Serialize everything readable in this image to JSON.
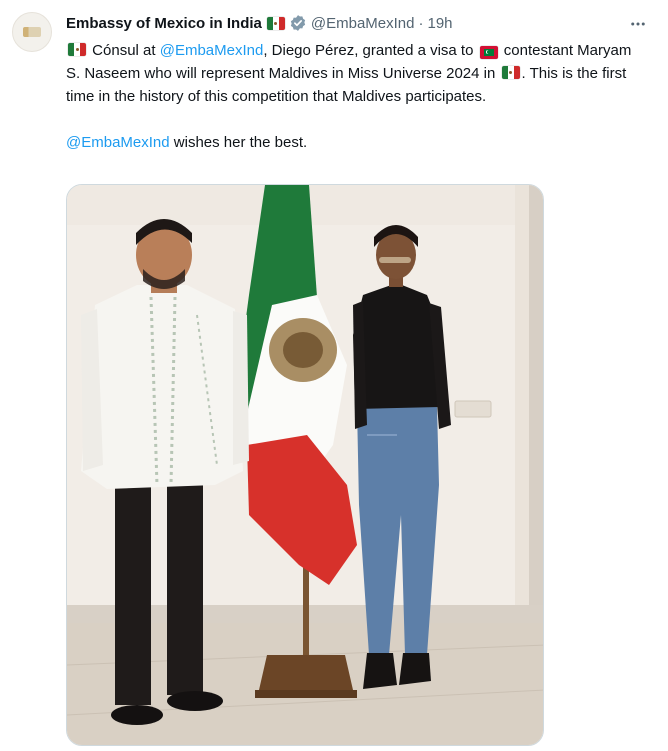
{
  "tweet": {
    "display_name": "Embassy of Mexico in India",
    "handle": "@EmbaMexInd",
    "separator": "·",
    "time": "19h",
    "body": {
      "p1_a": "Cónsul at ",
      "p1_mention": "@EmbaMexInd",
      "p1_b": ", Diego Pérez, granted a visa to ",
      "p1_c": " contestant Maryam S. Naseem who will represent Maldives in Miss Universe 2024 in ",
      "p1_d": ". This is the first time in the history of this competition that Maldives participates.",
      "p2_mention": "@EmbaMexInd",
      "p2_b": " wishes her the best."
    }
  },
  "icons": {
    "more": "more-horizontal-icon",
    "verified": "verified-badge-icon",
    "flag_mexico": "mexico-flag-icon",
    "flag_maldives": "maldives-flag-icon"
  },
  "colors": {
    "text": "#0f1419",
    "secondary": "#536471",
    "link": "#1d9bf0",
    "verified": "#829aab",
    "border": "#cfd9de"
  }
}
